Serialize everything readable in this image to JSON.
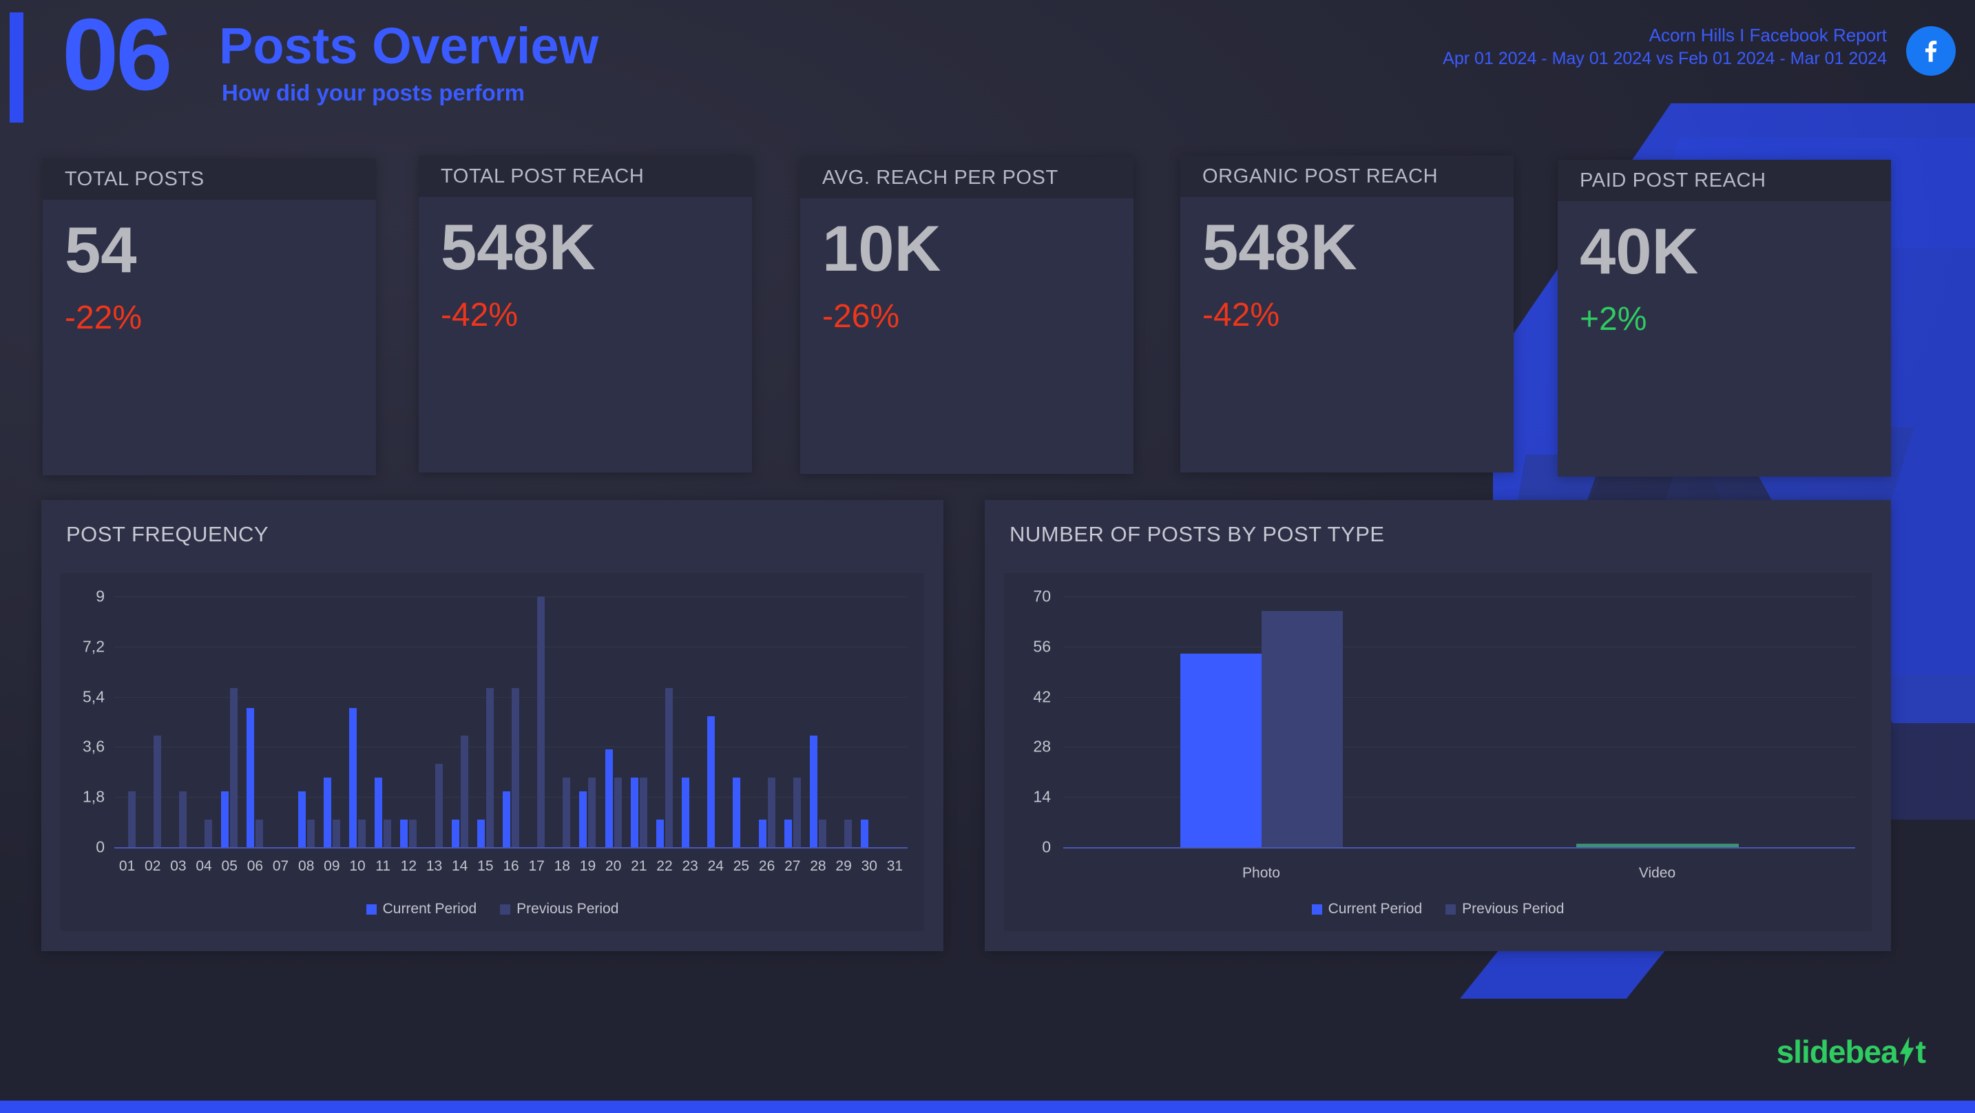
{
  "header": {
    "number": "06",
    "title": "Posts Overview",
    "subtitle": "How did your posts perform",
    "account_line": "Acorn Hills  I Facebook Report",
    "date_range_line": "Apr 01 2024 - May 01 2024 vs Feb 01 2024 - Mar 01 2024",
    "platform_icon": "facebook-icon"
  },
  "colors": {
    "accent_blue": "#2f4cf2",
    "title_blue": "#3a5bff",
    "negative_red": "#f0361a",
    "positive_green": "#2ecc61",
    "current_period": "#3a5bff",
    "previous_period": "#3a4276",
    "video_bar": "#3d8f73",
    "panel_bg": "#2e3047",
    "plot_bg": "#2a2c41",
    "page_bg": "#2a2b3d"
  },
  "kpis": [
    {
      "title": "TOTAL POSTS",
      "value": "54",
      "delta": "-22%",
      "delta_sign": "negative"
    },
    {
      "title": "TOTAL POST REACH",
      "value": "548K",
      "delta": "-42%",
      "delta_sign": "negative"
    },
    {
      "title": "AVG. REACH PER POST",
      "value": "10K",
      "delta": "-26%",
      "delta_sign": "negative"
    },
    {
      "title": "ORGANIC POST REACH",
      "value": "548K",
      "delta": "-42%",
      "delta_sign": "negative"
    },
    {
      "title": "PAID POST REACH",
      "value": "40K",
      "delta": "+2%",
      "delta_sign": "positive"
    }
  ],
  "panels": {
    "post_frequency_title": "POST FREQUENCY",
    "posts_by_type_title": "NUMBER OF POSTS BY POST TYPE"
  },
  "chart_data": [
    {
      "type": "bar",
      "title": "POST FREQUENCY",
      "xlabel": "",
      "ylabel": "",
      "ylim": [
        0,
        9
      ],
      "yticks": [
        0,
        1.8,
        3.6,
        5.4,
        7.2,
        9
      ],
      "ytick_labels": [
        "0",
        "1,8",
        "3,6",
        "5,4",
        "7,2",
        "9"
      ],
      "grid": true,
      "legend_position": "bottom",
      "categories": [
        "01",
        "02",
        "03",
        "04",
        "05",
        "06",
        "07",
        "08",
        "09",
        "10",
        "11",
        "12",
        "13",
        "14",
        "15",
        "16",
        "17",
        "18",
        "19",
        "20",
        "21",
        "22",
        "23",
        "24",
        "25",
        "26",
        "27",
        "28",
        "29",
        "30",
        "31"
      ],
      "series": [
        {
          "name": "Current Period",
          "color": "#3a5bff",
          "values": [
            0,
            0,
            0,
            0,
            2,
            5,
            0,
            2,
            2.5,
            5,
            2.5,
            1,
            0,
            1,
            1,
            2,
            0,
            0,
            2,
            3.5,
            2.5,
            1,
            2.5,
            4.7,
            2.5,
            1,
            1,
            4,
            0,
            1,
            0
          ]
        },
        {
          "name": "Previous Period",
          "color": "#3a4276",
          "values": [
            2,
            4,
            2,
            1,
            5.7,
            1,
            0,
            1,
            1,
            1,
            1,
            1,
            3,
            4,
            5.7,
            5.7,
            9,
            2.5,
            2.5,
            2.5,
            2.5,
            5.7,
            0,
            0,
            0,
            2.5,
            2.5,
            1,
            1,
            0,
            0
          ]
        }
      ]
    },
    {
      "type": "bar",
      "title": "NUMBER OF POSTS BY POST TYPE",
      "xlabel": "",
      "ylabel": "",
      "ylim": [
        0,
        70
      ],
      "yticks": [
        0,
        14,
        28,
        42,
        56,
        70
      ],
      "ytick_labels": [
        "0",
        "14",
        "28",
        "42",
        "56",
        "70"
      ],
      "grid": true,
      "legend_position": "bottom",
      "categories": [
        "Photo",
        "Video"
      ],
      "series": [
        {
          "name": "Current Period",
          "color": "#3a5bff",
          "values": [
            54,
            1
          ]
        },
        {
          "name": "Previous Period",
          "color": "#3a4276",
          "values": [
            66,
            1
          ]
        }
      ]
    }
  ],
  "legend": {
    "current_label": "Current Period",
    "previous_label": "Previous Period"
  },
  "footer": {
    "brand": "slidebeast",
    "brand_part_1": "slidebea",
    "brand_part_2": "t"
  }
}
